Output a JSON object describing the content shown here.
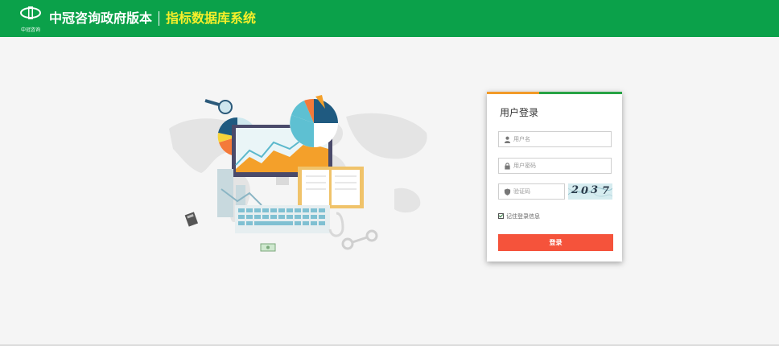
{
  "header": {
    "logo_caption": "中冠咨询",
    "brand_name": "中冠咨询政府版本",
    "system_name": "指标数据库系统"
  },
  "login": {
    "title": "用户登录",
    "username_placeholder": "用户名",
    "password_placeholder": "用户密码",
    "captcha_placeholder": "验证码",
    "captcha_digits": [
      "2",
      "0",
      "3",
      "7"
    ],
    "remember_label": "记住登录信息",
    "submit_label": "登录"
  },
  "colors": {
    "header_bg": "#0ba14a",
    "system_name": "#f7ef2a",
    "login_button": "#f5533b",
    "card_accent_orange": "#f29a28",
    "card_accent_green": "#27a345"
  }
}
